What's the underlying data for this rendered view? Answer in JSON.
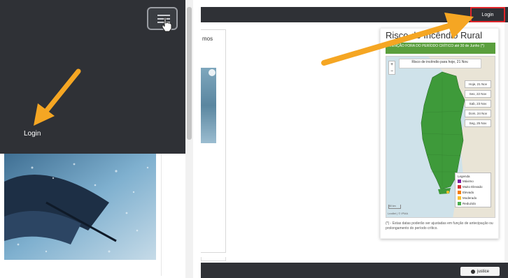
{
  "left_panel": {
    "menu": {
      "login_label": "Login"
    }
  },
  "right_panel": {
    "top_bar": {
      "login_label": "Login"
    },
    "card": {
      "title_fragment": "mos"
    },
    "widget": {
      "title": "Risco de Incêndio Rural",
      "banner_text": "ATENÇÃO FORA DO PERÍODO CRÍTICO até 30 de Junho (*)",
      "map_title": "Risco de incêndio para hoje, 21 Nov.",
      "zoom_in": "+",
      "zoom_out": "−",
      "day_buttons": [
        "Hoje, 21 Nov",
        "Sex, 22 Nov",
        "Sab, 23 Nov",
        "Dom, 24 Nov",
        "Seg, 25 Nov"
      ],
      "legend": {
        "title": "Legenda",
        "items": [
          {
            "label": "Máximo",
            "color": "#7b1fa2"
          },
          {
            "label": "Muito Elevado",
            "color": "#d32f2f"
          },
          {
            "label": "Elevado",
            "color": "#f57c00"
          },
          {
            "label": "Moderado",
            "color": "#fbc02d"
          },
          {
            "label": "Reduzido",
            "color": "#4caf50"
          }
        ]
      },
      "scale_label": "50 km",
      "attribution": "Leaflet | © IPMA",
      "note": "(*) - Estas datas poderão ser ajustadas em função de antecipação ou prolongamento do período crítico."
    },
    "footer": {
      "badge_label": "justice"
    }
  },
  "colors": {
    "dark_bar": "#2f3136",
    "highlight_red": "#e0262b",
    "arrow_orange": "#f5a623",
    "banner_green": "#5a9f3d"
  },
  "icons": [
    "hamburger-menu-icon",
    "hand-cursor-icon",
    "camera-icon",
    "arrow-annotation-icon"
  ]
}
